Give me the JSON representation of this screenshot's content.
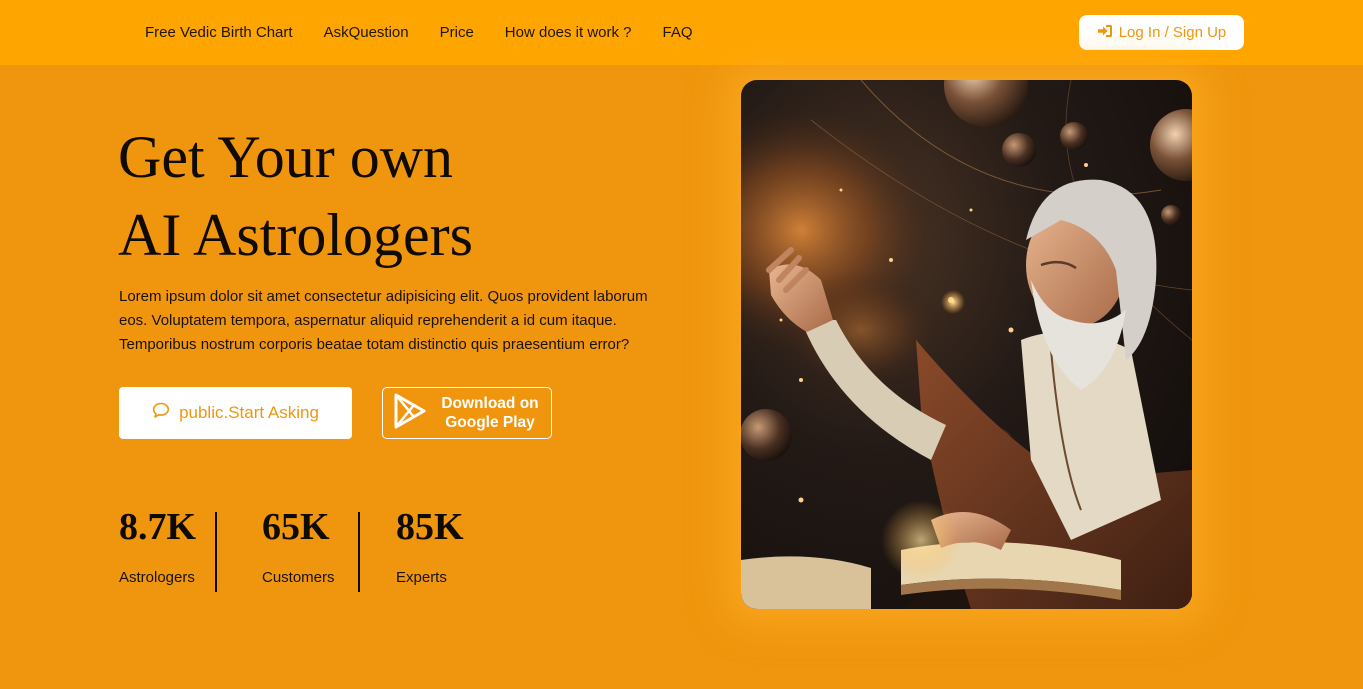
{
  "nav": {
    "links": [
      "Free Vedic Birth Chart",
      "AskQuestion",
      "Price",
      "How does it work ?",
      "FAQ"
    ],
    "login_label": "Log In / Sign Up"
  },
  "hero": {
    "title_line1": "Get Your own",
    "title_line2": "AI Astrologers",
    "description": "Lorem ipsum dolor sit amet consectetur adipisicing elit. Quos provident laborum eos. Voluptatem tempora, aspernatur aliquid reprehenderit a id cum itaque. Temporibus nostrum corporis beatae totam distinctio quis praesentium error?",
    "ask_button_label": "public.Start Asking",
    "play_line1": "Download on",
    "play_line2": "Google Play"
  },
  "stats": [
    {
      "value": "8.7K",
      "label": "Astrologers"
    },
    {
      "value": "65K",
      "label": "Customers"
    },
    {
      "value": "85K",
      "label": "Experts"
    }
  ],
  "colors": {
    "background": "#ef960e",
    "navbar": "#ffa500",
    "accent": "#ef960e",
    "text_dark": "#0f0a02"
  },
  "icons": {
    "login": "sign-in-icon",
    "ask": "chat-bubble-icon",
    "play": "google-play-icon"
  }
}
